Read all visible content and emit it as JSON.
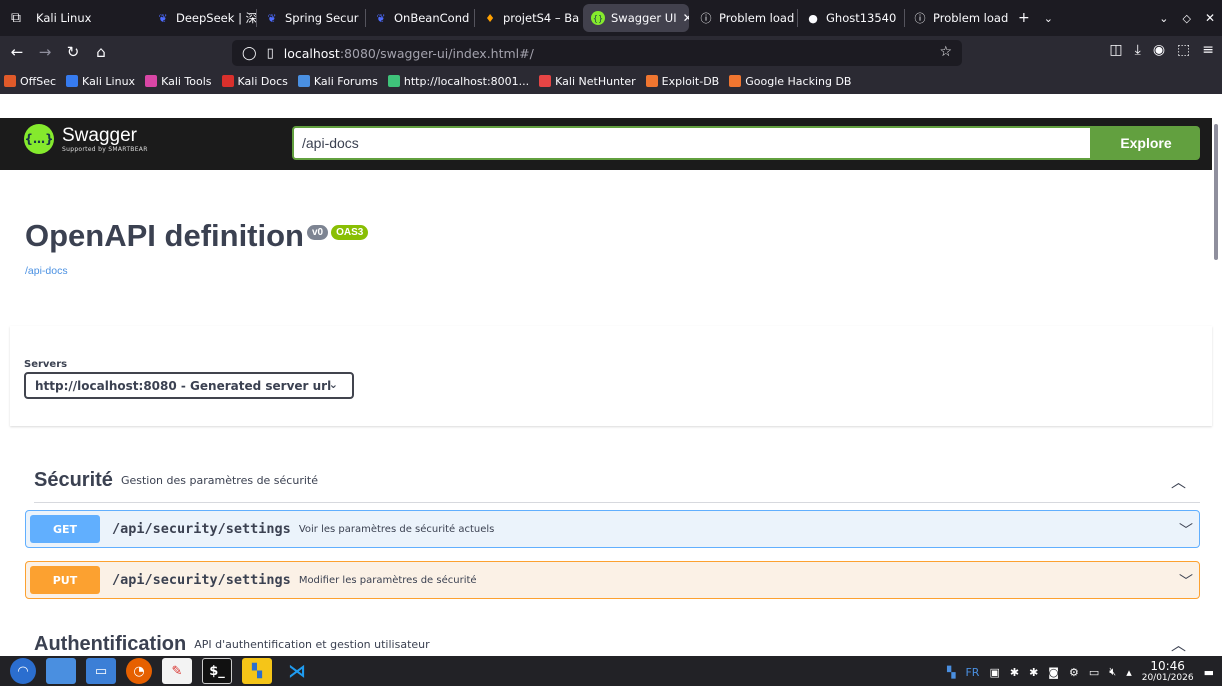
{
  "browser": {
    "tabs": [
      {
        "label": "Kali Linux",
        "icon": "window-icon",
        "active": false
      },
      {
        "label": "DeepSeek | 深",
        "icon": "deepseek-icon",
        "active": false
      },
      {
        "label": "Spring Secur",
        "icon": "deepseek-icon",
        "active": false
      },
      {
        "label": "OnBeanCond",
        "icon": "deepseek-icon",
        "active": false
      },
      {
        "label": "projetS4 – Ba",
        "icon": "firebase-icon",
        "active": false
      },
      {
        "label": "Swagger UI",
        "icon": "swagger-icon",
        "active": true
      },
      {
        "label": "Problem load",
        "icon": "info-icon",
        "active": false
      },
      {
        "label": "Ghost13540",
        "icon": "github-icon",
        "active": false
      },
      {
        "label": "Problem load",
        "icon": "info-icon",
        "active": false
      }
    ],
    "url_host": "localhost",
    "url_path": ":8080/swagger-ui/index.html#/",
    "bookmarks": [
      {
        "label": "OffSec",
        "color": "#e05a2a"
      },
      {
        "label": "Kali Linux",
        "color": "#367bf0"
      },
      {
        "label": "Kali Tools",
        "color": "#d946a6"
      },
      {
        "label": "Kali Docs",
        "color": "#d9302c"
      },
      {
        "label": "Kali Forums",
        "color": "#4a90e2"
      },
      {
        "label": "http://localhost:8001...",
        "color": "#3fc37a"
      },
      {
        "label": "Kali NetHunter",
        "color": "#e64545"
      },
      {
        "label": "Exploit-DB",
        "color": "#f07630"
      },
      {
        "label": "Google Hacking DB",
        "color": "#f07630"
      }
    ]
  },
  "swagger": {
    "logo_text": "Swagger",
    "logo_sub": "Supported by SMARTBEAR",
    "spec_url": "/api-docs",
    "explore_label": "Explore",
    "title": "OpenAPI definition",
    "version_badge": "v0",
    "oas_badge": "OAS3",
    "docs_link": "/api-docs",
    "servers_label": "Servers",
    "server_selected": "http://localhost:8080 - Generated server url",
    "tags": [
      {
        "name": "Sécurité",
        "description": "Gestion des paramètres de sécurité",
        "operations": [
          {
            "method": "GET",
            "path": "/api/security/settings",
            "summary": "Voir les paramètres de sécurité actuels"
          },
          {
            "method": "PUT",
            "path": "/api/security/settings",
            "summary": "Modifier les paramètres de sécurité"
          }
        ]
      },
      {
        "name": "Authentification",
        "description": "API d'authentification et gestion utilisateur"
      }
    ]
  },
  "taskbar": {
    "lang": "FR",
    "time": "10:46",
    "date": "20/01/2026"
  },
  "colors": {
    "get": "#61affe",
    "put": "#fca130",
    "swagger_green": "#62a03f"
  }
}
